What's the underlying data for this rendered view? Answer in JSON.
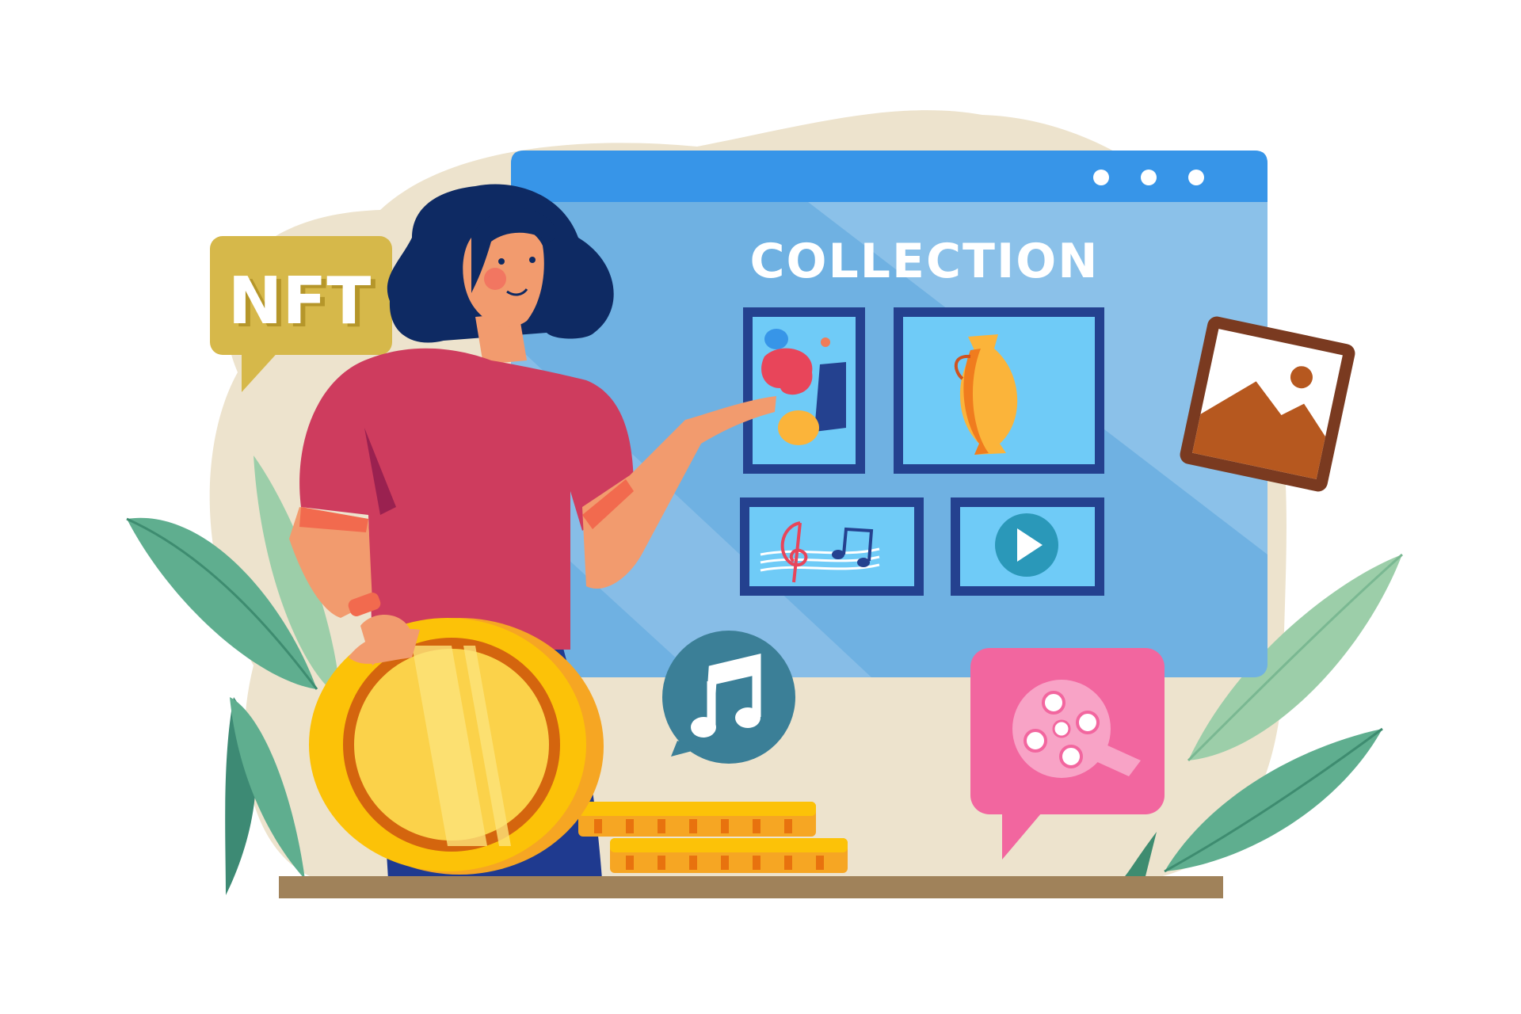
{
  "illustration": {
    "badge_text": "NFT",
    "window_heading": "COLLECTION",
    "window_dots_count": 3,
    "gallery_tiles": [
      {
        "kind": "abstract-art",
        "icon": "abstract-shapes-icon"
      },
      {
        "kind": "vase",
        "icon": "vase-icon"
      },
      {
        "kind": "music",
        "icon": "music-score-icon"
      },
      {
        "kind": "video",
        "icon": "play-icon"
      }
    ],
    "floating_icons": [
      "image-icon",
      "music-note-icon",
      "film-reel-icon"
    ],
    "colors": {
      "browser_bar": "#3795e8",
      "browser_body": "#6fb1e2",
      "tile_frame": "#24418f",
      "tile_fill": "#6fcbf7",
      "nft_badge": "#d6b84a",
      "coin_gold": "#fcc208",
      "shirt": "#ce3c5e",
      "music_bubble": "#3b7f97",
      "film_bubble": "#f2669f",
      "image_frame": "#7a3a20",
      "backdrop": "#ede3cd",
      "table": "#a0825a",
      "leaf": "#5fae8f"
    }
  }
}
